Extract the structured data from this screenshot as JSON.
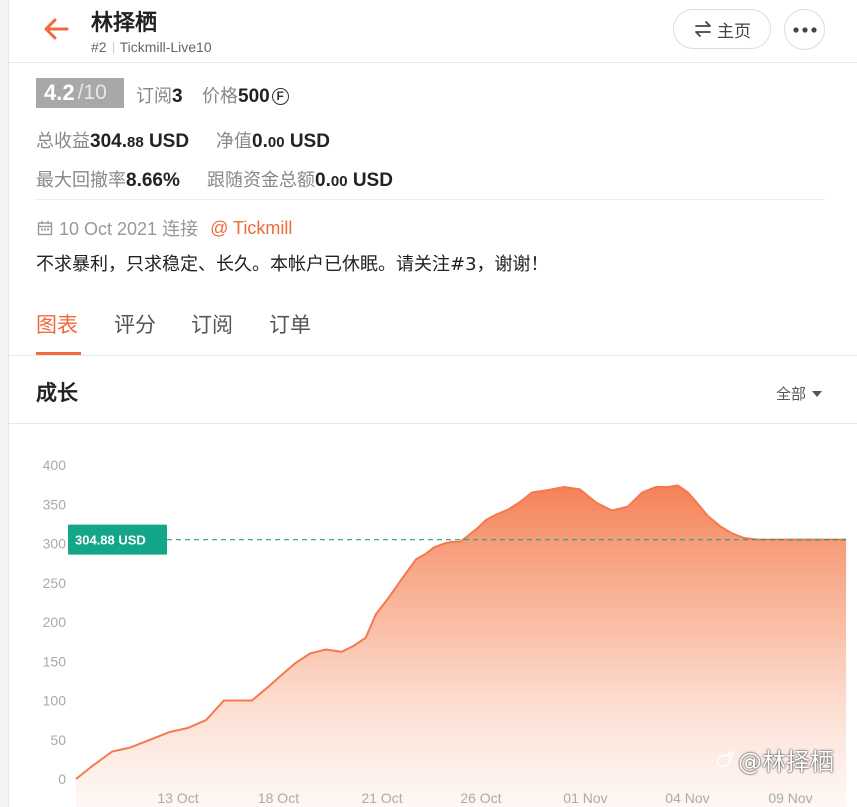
{
  "header": {
    "title": "林择栖",
    "rank": "#2",
    "server": "Tickmill-Live10",
    "home_label": "主页"
  },
  "rating": {
    "score": "4.2",
    "denominator": "/10"
  },
  "stats": {
    "subscriptions_label": "订阅",
    "subscriptions_value": "3",
    "price_label": "价格",
    "price_value": "500",
    "currency_symbol": "F",
    "total_profit_label": "总收益",
    "total_profit_int": "304.",
    "total_profit_dec": "88",
    "total_profit_unit": "USD",
    "net_value_label": "净值",
    "net_value_int": "0.",
    "net_value_dec": "00",
    "net_value_unit": "USD",
    "max_drawdown_label": "最大回撤率",
    "max_drawdown_value": "8.66%",
    "follow_funds_label": "跟随资金总额",
    "follow_funds_int": "0.",
    "follow_funds_dec": "00",
    "follow_funds_unit": "USD"
  },
  "connection": {
    "date": "10 Oct 2021 连接",
    "broker": "@ Tickmill"
  },
  "description": "不求暴利，只求稳定、长久。本帐户已休眠。请关注#3，谢谢！",
  "tabs": [
    {
      "label": "图表",
      "active": true
    },
    {
      "label": "评分",
      "active": false
    },
    {
      "label": "订阅",
      "active": false
    },
    {
      "label": "订单",
      "active": false
    }
  ],
  "section": {
    "title": "成长",
    "filter_label": "全部"
  },
  "colors": {
    "accent": "#f06a3b",
    "current_badge": "#14a689"
  },
  "chart_data": {
    "type": "area",
    "ylim": [
      0,
      400
    ],
    "yticks": [
      "0",
      "50",
      "100",
      "150",
      "200",
      "250",
      "300",
      "350",
      "400"
    ],
    "xtick_labels": [
      "13 Oct",
      "18 Oct",
      "21 Oct",
      "26 Oct",
      "01 Nov",
      "04 Nov",
      "09 Nov"
    ],
    "xtick_positions": [
      0.2,
      0.397,
      0.6,
      0.794,
      0.999,
      1.199,
      1.401
    ],
    "current_value_label": "304.88 USD",
    "current_value": 304.88,
    "series": [
      {
        "x": [
          0,
          0.031,
          0.071,
          0.106,
          0.145,
          0.184,
          0.219,
          0.255,
          0.29,
          0.321,
          0.345,
          0.376,
          0.404,
          0.431,
          0.459,
          0.49,
          0.521,
          0.545,
          0.568,
          0.588,
          0.612,
          0.639,
          0.667,
          0.686,
          0.702,
          0.722,
          0.737,
          0.753,
          0.769,
          0.788,
          0.804,
          0.824,
          0.847,
          0.871,
          0.894,
          0.925,
          0.957,
          0.988,
          1.02,
          1.051,
          1.082,
          1.11,
          1.137,
          1.161,
          1.18,
          1.2,
          1.22,
          1.239,
          1.263,
          1.286,
          1.31,
          1.337,
          1.361,
          1.388,
          1.416,
          1.431,
          1.447,
          1.463,
          1.486,
          1.51
        ],
        "y": [
          0,
          16,
          35,
          40,
          50,
          60,
          65,
          75,
          100,
          100,
          100,
          117,
          133,
          148,
          160,
          165,
          162,
          170,
          180,
          210,
          230,
          255,
          280,
          287,
          295,
          300,
          302,
          302,
          310,
          320,
          330,
          337,
          343,
          353,
          365,
          368,
          372,
          369,
          352,
          342,
          347,
          365,
          372,
          372,
          374,
          365,
          350,
          335,
          322,
          313,
          307,
          305,
          305,
          305,
          305,
          305,
          305,
          305,
          305,
          305
        ]
      }
    ]
  }
}
